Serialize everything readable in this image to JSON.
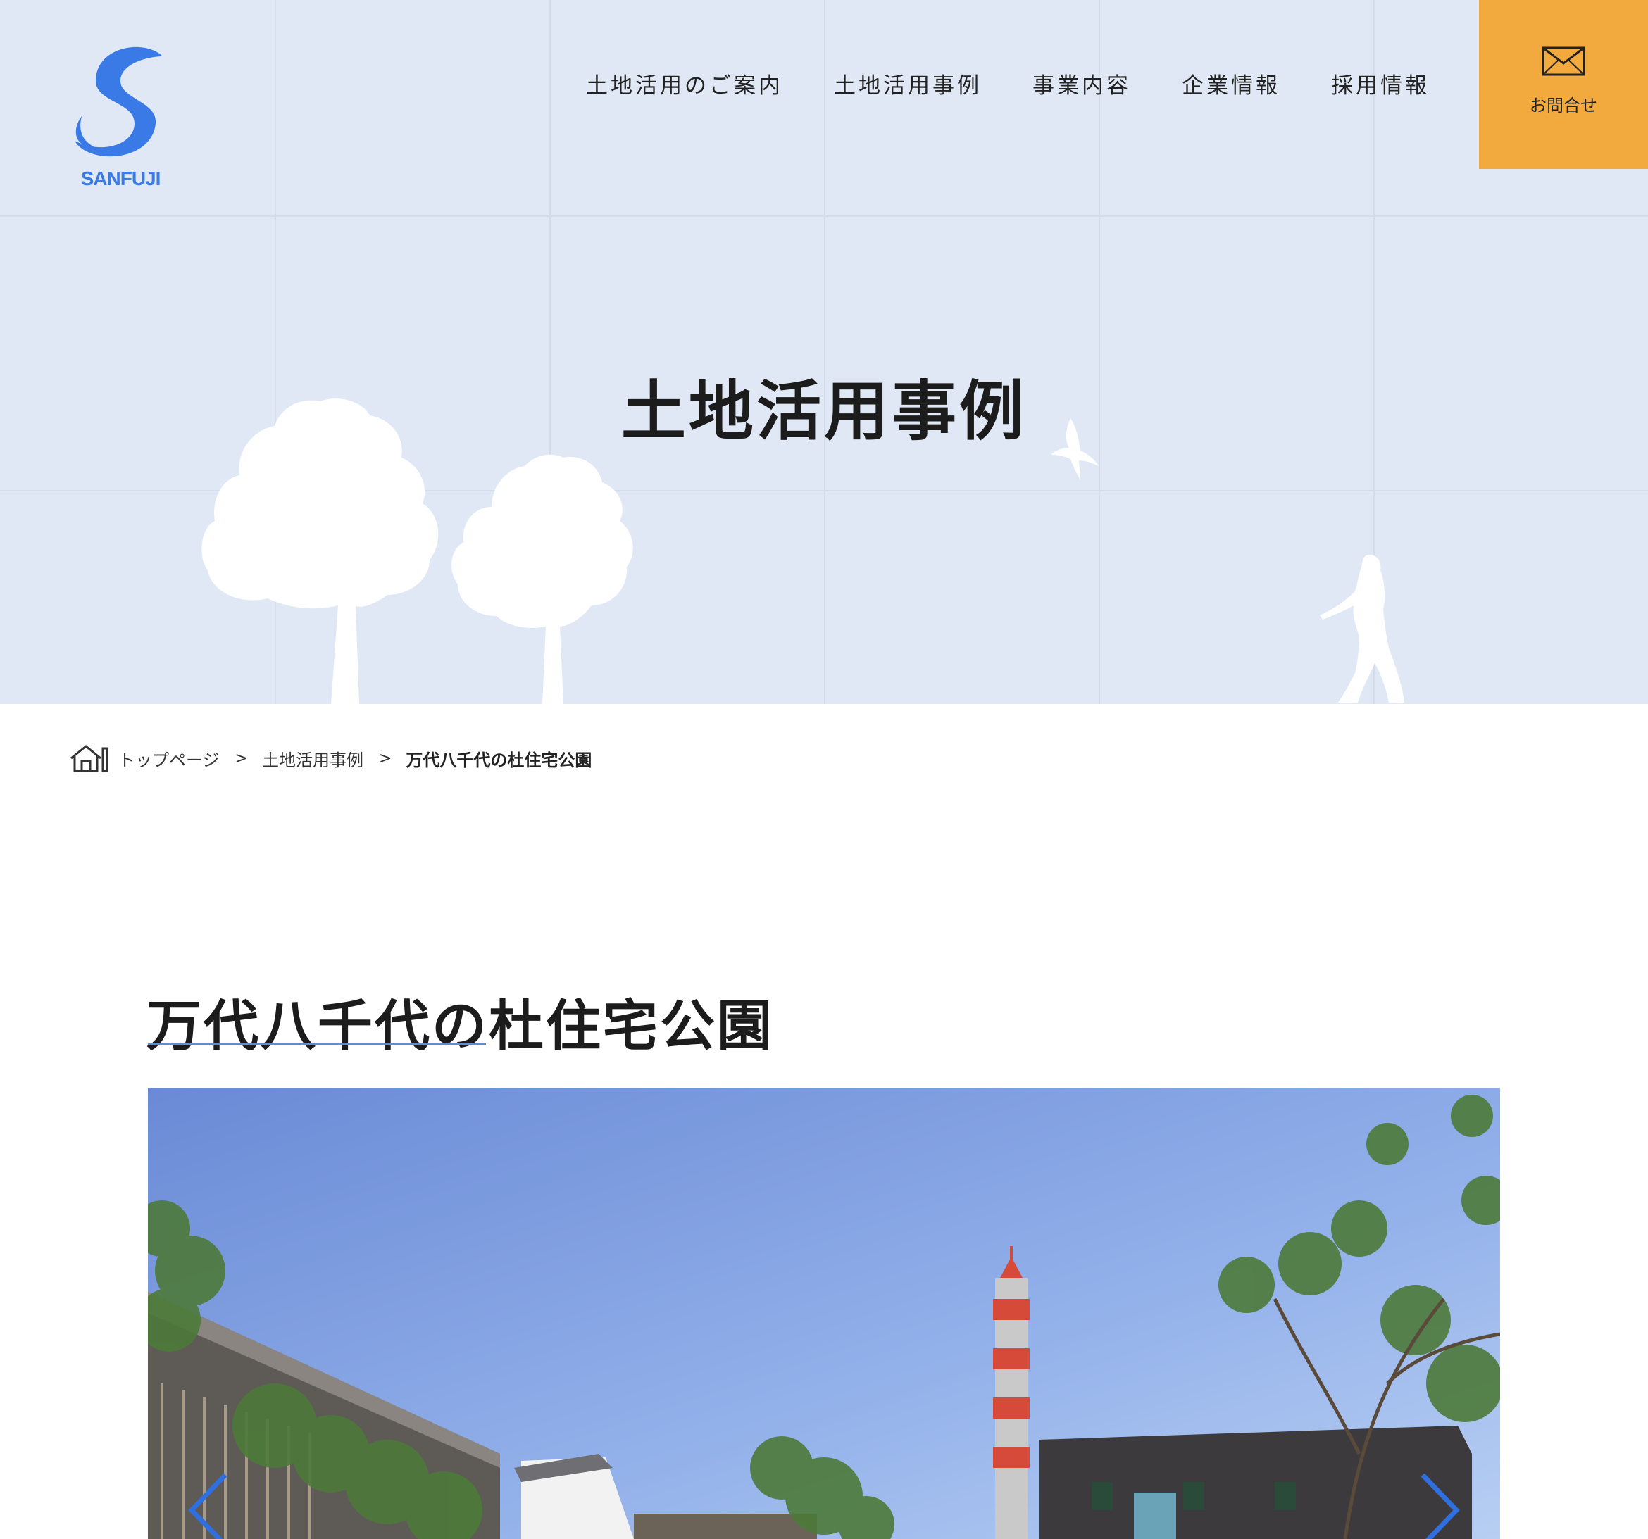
{
  "header": {
    "logo_text": "SANFUJI",
    "nav": [
      {
        "label": "土地活用のご案内"
      },
      {
        "label": "土地活用事例"
      },
      {
        "label": "事業内容"
      },
      {
        "label": "企業情報"
      },
      {
        "label": "採用情報"
      }
    ],
    "contact_label": "お問合せ",
    "contact_icon": "mail-icon"
  },
  "hero": {
    "title": "土地活用事例"
  },
  "breadcrumb": {
    "home_icon": "home-icon",
    "items": [
      "トップページ",
      "土地活用事例"
    ],
    "current": "万代八千代の杜住宅公園",
    "separator": ">"
  },
  "article": {
    "title": "万代八千代の杜住宅公園"
  },
  "slider": {
    "prev_icon": "chevron-left-icon",
    "next_icon": "chevron-right-icon"
  },
  "colors": {
    "hero_bg": "#dfe8f4",
    "accent": "#3a7ae6",
    "contact_bg": "#f2aa3e",
    "rule": "#5b8fdc"
  }
}
